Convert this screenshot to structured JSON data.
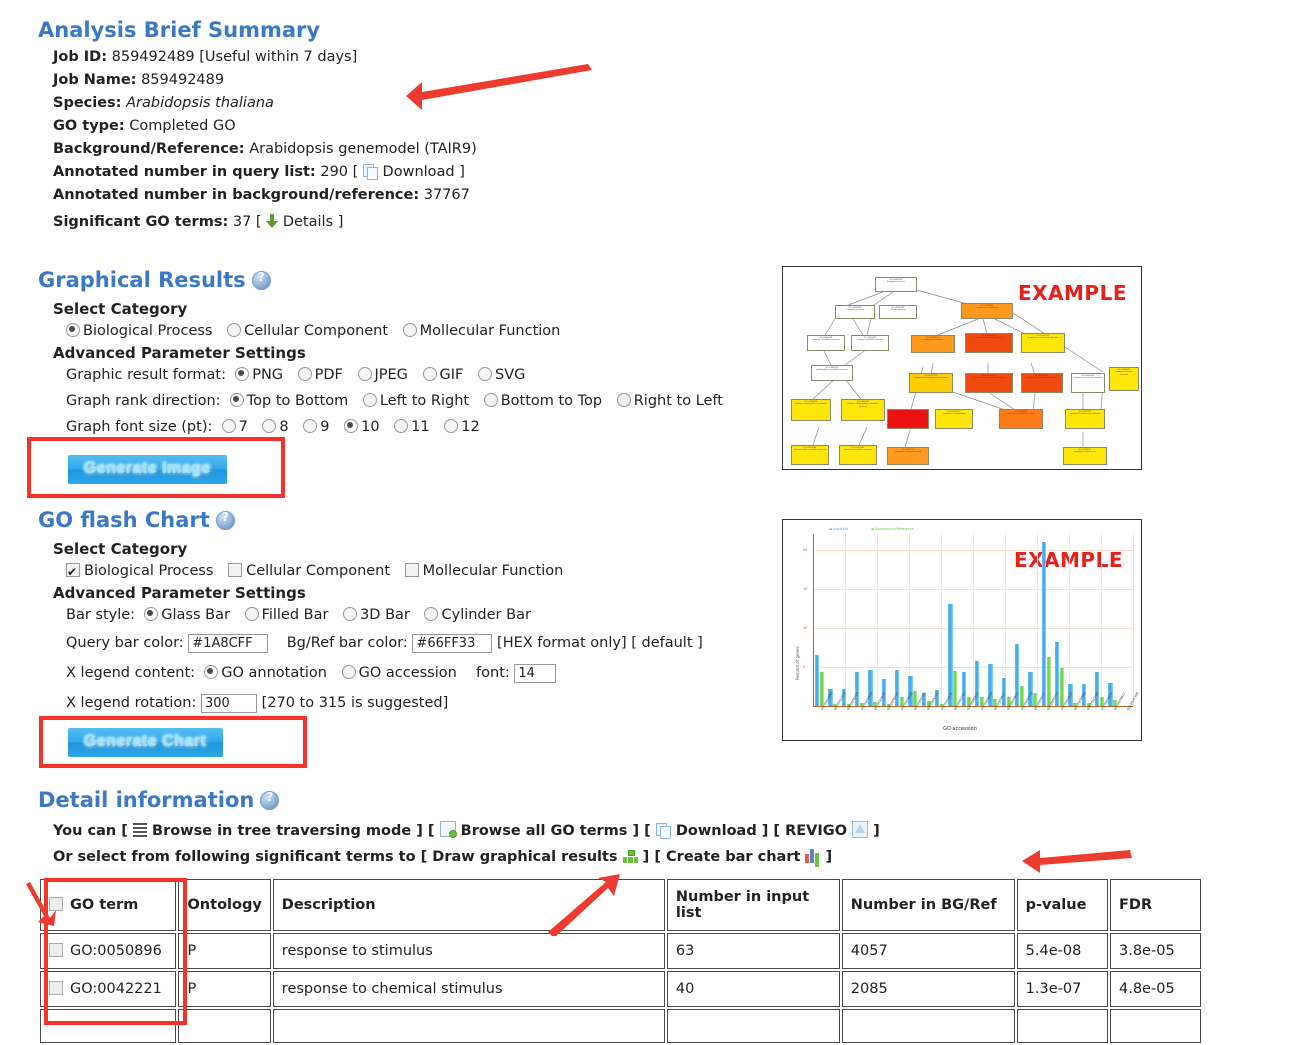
{
  "summary": {
    "heading": "Analysis Brief Summary",
    "items": [
      {
        "label": "Job ID:",
        "value": "859492489 [Useful within 7 days]"
      },
      {
        "label": "Job Name:",
        "value": "859492489"
      },
      {
        "label": "Species:",
        "value": "Arabidopsis thaliana"
      },
      {
        "label": "GO type:",
        "value": "Completed GO"
      },
      {
        "label": "Background/Reference:",
        "value": "Arabidopsis genemodel (TAIR9)"
      }
    ],
    "annotated_query_label": "Annotated number in query list:",
    "annotated_query_value": "290",
    "download_label": "Download",
    "annotated_bg_label": "Annotated number in background/reference:",
    "annotated_bg_value": "37767",
    "significant_label": "Significant GO terms:",
    "significant_value": "37",
    "details_label": "Details",
    "bracket_open": "[",
    "bracket_close": "]"
  },
  "graphical": {
    "heading": "Graphical Results",
    "select_category_label": "Select Category",
    "categories": [
      {
        "label": "Biological Process",
        "selected": true
      },
      {
        "label": "Cellular Component",
        "selected": false
      },
      {
        "label": "Mollecular Function",
        "selected": false
      }
    ],
    "advanced_label": "Advanced Parameter Settings",
    "format_label": "Graphic result format:",
    "formats": [
      {
        "label": "PNG",
        "selected": true
      },
      {
        "label": "PDF",
        "selected": false
      },
      {
        "label": "JPEG",
        "selected": false
      },
      {
        "label": "GIF",
        "selected": false
      },
      {
        "label": "SVG",
        "selected": false
      }
    ],
    "rank_label": "Graph rank direction:",
    "rank_options": [
      {
        "label": "Top to Bottom",
        "selected": true
      },
      {
        "label": "Left to Right",
        "selected": false
      },
      {
        "label": "Bottom to Top",
        "selected": false
      },
      {
        "label": "Right to Left",
        "selected": false
      }
    ],
    "fontsize_label": "Graph font size (pt):",
    "fontsizes": [
      {
        "label": "7",
        "selected": false
      },
      {
        "label": "8",
        "selected": false
      },
      {
        "label": "9",
        "selected": false
      },
      {
        "label": "10",
        "selected": true
      },
      {
        "label": "11",
        "selected": false
      },
      {
        "label": "12",
        "selected": false
      }
    ],
    "generate_button": "Generate Image"
  },
  "flash": {
    "heading": "GO flash Chart",
    "select_category_label": "Select Category",
    "categories": [
      {
        "label": "Biological Process",
        "checked": true
      },
      {
        "label": "Cellular Component",
        "checked": false
      },
      {
        "label": "Mollecular Function",
        "checked": false
      }
    ],
    "advanced_label": "Advanced Parameter Settings",
    "bar_style_label": "Bar style:",
    "bar_styles": [
      {
        "label": "Glass Bar",
        "selected": true
      },
      {
        "label": "Filled Bar",
        "selected": false
      },
      {
        "label": "3D Bar",
        "selected": false
      },
      {
        "label": "Cylinder Bar",
        "selected": false
      }
    ],
    "query_color_label": "Query bar color:",
    "query_color_value": "#1A8CFF",
    "bgref_color_label": "Bg/Ref bar color:",
    "bgref_color_value": "#66FF33",
    "hex_note": "[HEX format only]",
    "default_note": "[ default ]",
    "legend_content_label": "X legend content:",
    "legend_options": [
      {
        "label": "GO annotation",
        "selected": true
      },
      {
        "label": "GO accession",
        "selected": false
      }
    ],
    "font_label": "font:",
    "font_value": "14",
    "rotation_label": "X legend rotation:",
    "rotation_value": "300",
    "rotation_note": "[270 to 315 is suggested]",
    "generate_button": "Generate Chart"
  },
  "detail": {
    "heading": "Detail information",
    "line1_prefix": "You can [",
    "browse_tree": "Browse in tree traversing mode",
    "browse_all": "Browse all GO terms",
    "download": "Download",
    "revigo": "REVIGO",
    "line2_prefix": "Or select from following significant terms to [",
    "draw_graphical": "Draw graphical results",
    "create_bar": "Create bar chart"
  },
  "table": {
    "columns": [
      "GO term",
      "Ontology",
      "Description",
      "Number in input list",
      "Number in BG/Ref",
      "p-value",
      "FDR"
    ],
    "rows": [
      {
        "go": "GO:0050896",
        "ontology": "P",
        "description": "response to stimulus",
        "input": "63",
        "bgref": "4057",
        "pvalue": "5.4e-08",
        "fdr": "3.8e-05"
      },
      {
        "go": "GO:0042221",
        "ontology": "P",
        "description": "response to chemical stimulus",
        "input": "40",
        "bgref": "2085",
        "pvalue": "1.3e-07",
        "fdr": "4.8e-05"
      }
    ]
  },
  "thumbnails": {
    "dag": {
      "watermark": "EXAMPLE"
    },
    "chart": {
      "watermark": "EXAMPLE",
      "xlabel": "GO accession",
      "ylabel": "Percent of genes",
      "legend": [
        "Input list",
        "Background/Reference"
      ]
    }
  },
  "chart_data": {
    "type": "bar",
    "title": "",
    "xlabel": "GO accession",
    "ylabel": "Percent of genes",
    "ylim": [
      0,
      22
    ],
    "yticks": [
      0,
      5,
      10,
      15,
      20
    ],
    "grid": true,
    "legend_position": "top-left",
    "categories": [
      "GO:0050896",
      "GO:0042221",
      "GO:0009719",
      "GO:0006950",
      "GO:0010033",
      "GO:0009725",
      "GO:0009628",
      "GO:0009751",
      "GO:0009733",
      "GO:0010035",
      "GO:0042742",
      "GO:0006952",
      "GO:0009414",
      "GO:0009617",
      "GO:0009611",
      "GO:0006979",
      "GO:0009737",
      "GO:0009753",
      "GO:0050832",
      "GO:0009408",
      "GO:0010200",
      "GO:0009651",
      "GO:0009627",
      "GO:0031348"
    ],
    "series": [
      {
        "name": "Input list",
        "color": "#1A8CFF",
        "values": [
          6.5,
          2.2,
          2.2,
          4.3,
          4.6,
          3.4,
          4.6,
          3.9,
          1.7,
          2.0,
          13.0,
          4.3,
          5.7,
          5.4,
          3.6,
          7.9,
          4.3,
          21.0,
          8.2,
          2.8,
          2.8,
          4.3,
          3.0,
          0
        ]
      },
      {
        "name": "Background/Reference",
        "color": "#66FF33",
        "values": [
          4.3,
          0.3,
          0.3,
          0.4,
          0.5,
          0.3,
          1.1,
          1.9,
          0.6,
          0.2,
          4.5,
          1.2,
          1.1,
          0.9,
          1.2,
          2.6,
          1.7,
          6.3,
          4.8,
          0.4,
          0.4,
          1.2,
          0.8,
          0
        ]
      }
    ]
  }
}
